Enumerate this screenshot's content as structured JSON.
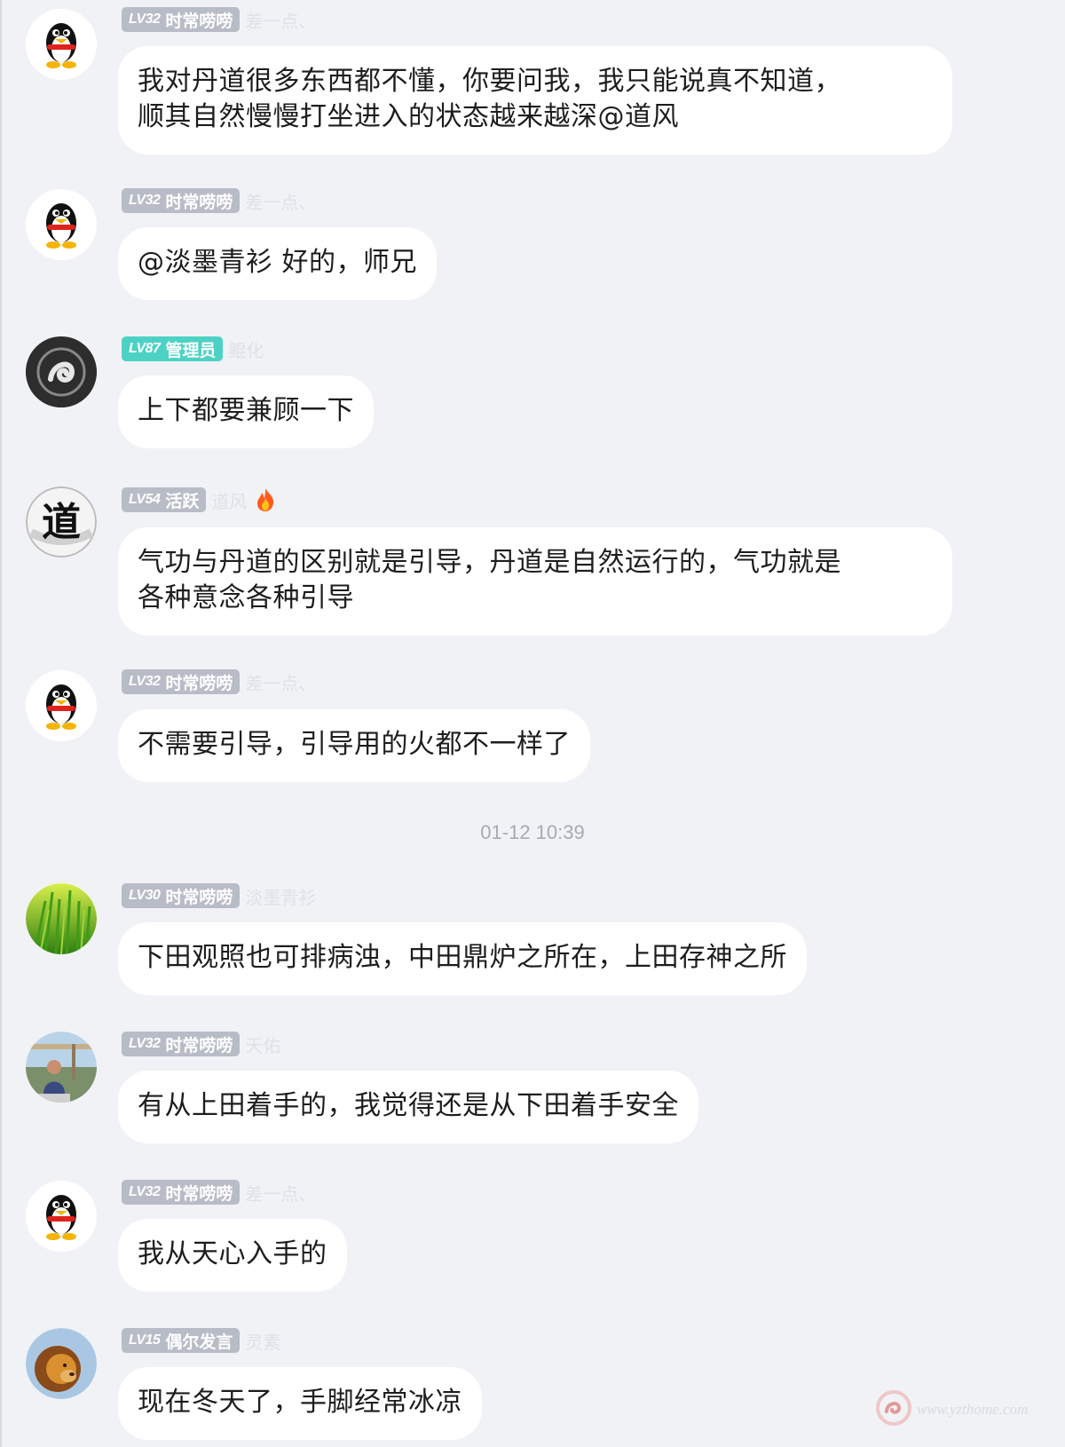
{
  "messages": [
    {
      "avatar": "qq-penguin-avatar",
      "level": "LV32",
      "title": "时常唠唠",
      "badge_color": "#b8bcc7",
      "nickname": "差一点、",
      "text": [
        "我对丹道很多东西都不懂，你要问我，我只能说真不知道，",
        "顺其自然慢慢打坐进入的状态越来越深@道风"
      ]
    },
    {
      "avatar": "qq-penguin-avatar",
      "level": "LV32",
      "title": "时常唠唠",
      "badge_color": "#b8bcc7",
      "nickname": "差一点、",
      "text": [
        "@淡墨青衫 好的，师兄"
      ]
    },
    {
      "avatar": "swirl-logo-avatar",
      "level": "LV87",
      "title": "管理员",
      "badge_color": "#4cd2c4",
      "nickname": "鲲化",
      "text": [
        "上下都要兼顾一下"
      ]
    },
    {
      "avatar": "dao-character-avatar",
      "avatar_char": "道",
      "level": "LV54",
      "title": "活跃",
      "badge_color": "#b8bcc7",
      "nickname": "道风",
      "nickname_icon": "fire-icon",
      "text": [
        "气功与丹道的区别就是引导，丹道是自然运行的，气功就是",
        "各种意念各种引导"
      ]
    },
    {
      "avatar": "qq-penguin-avatar",
      "level": "LV32",
      "title": "时常唠唠",
      "badge_color": "#b8bcc7",
      "nickname": "差一点、",
      "text": [
        "不需要引导，引导用的火都不一样了"
      ]
    },
    {
      "avatar": "green-grass-avatar",
      "level": "LV30",
      "title": "时常唠唠",
      "badge_color": "#b8bcc7",
      "nickname": "淡墨青衫",
      "text": [
        "下田观照也可排病浊，中田鼎炉之所在，上田存神之所"
      ]
    },
    {
      "avatar": "person-photo-avatar",
      "level": "LV32",
      "title": "时常唠唠",
      "badge_color": "#b8bcc7",
      "nickname": "天佑",
      "text": [
        "有从上田着手的，我觉得还是从下田着手安全"
      ]
    },
    {
      "avatar": "qq-penguin-avatar",
      "level": "LV32",
      "title": "时常唠唠",
      "badge_color": "#b8bcc7",
      "nickname": "差一点、",
      "text": [
        "我从天心入手的"
      ]
    },
    {
      "avatar": "lion-photo-avatar",
      "level": "LV15",
      "title": "偶尔发言",
      "badge_color": "#b8bcc7",
      "nickname": "灵素",
      "text": [
        "现在冬天了，手脚经常冰凉"
      ]
    }
  ],
  "timestamp": "01-12 10:39",
  "watermark": {
    "icon": "yzthome-logo-icon",
    "text": "www.yzthome.com"
  }
}
